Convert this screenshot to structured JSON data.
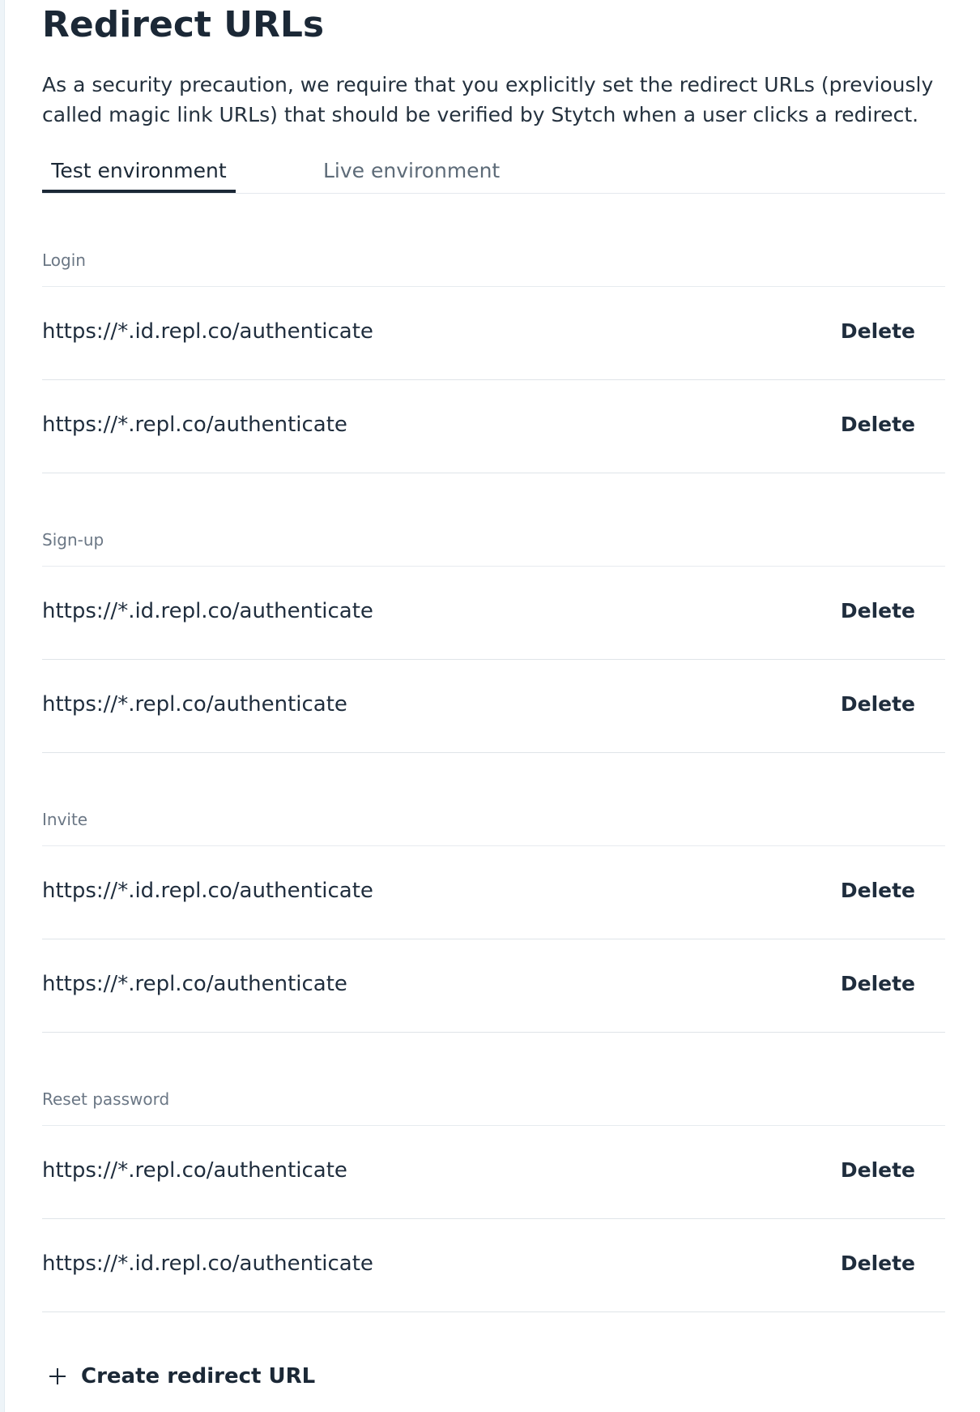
{
  "page": {
    "title": "Redirect URLs",
    "description": "As a security precaution, we require that you explicitly set the redirect URLs (previously called magic link URLs) that should be verified by Stytch when a user clicks a redirect."
  },
  "tabs": [
    {
      "label": "Test environment",
      "active": true
    },
    {
      "label": "Live environment",
      "active": false
    }
  ],
  "sections": [
    {
      "label": "Login",
      "urls": [
        {
          "url": "https://*.id.repl.co/authenticate",
          "action": "Delete"
        },
        {
          "url": "https://*.repl.co/authenticate",
          "action": "Delete"
        }
      ]
    },
    {
      "label": "Sign-up",
      "urls": [
        {
          "url": "https://*.id.repl.co/authenticate",
          "action": "Delete"
        },
        {
          "url": "https://*.repl.co/authenticate",
          "action": "Delete"
        }
      ]
    },
    {
      "label": "Invite",
      "urls": [
        {
          "url": "https://*.id.repl.co/authenticate",
          "action": "Delete"
        },
        {
          "url": "https://*.repl.co/authenticate",
          "action": "Delete"
        }
      ]
    },
    {
      "label": "Reset password",
      "urls": [
        {
          "url": "https://*.repl.co/authenticate",
          "action": "Delete"
        },
        {
          "url": "https://*.id.repl.co/authenticate",
          "action": "Delete"
        }
      ]
    }
  ],
  "create_button": {
    "label": "Create redirect URL",
    "icon": "plus-icon"
  },
  "colors": {
    "text_primary": "#1b2836",
    "text_muted": "#6b7785",
    "divider": "#dfe4e8"
  }
}
